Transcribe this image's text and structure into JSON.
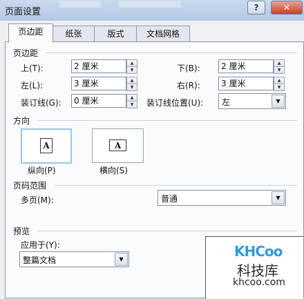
{
  "window": {
    "title": "页面设置",
    "help_label": "?",
    "close_label": "✕"
  },
  "tabs": [
    {
      "label": "页边距",
      "active": true
    },
    {
      "label": "纸张",
      "active": false
    },
    {
      "label": "版式",
      "active": false
    },
    {
      "label": "文档网格",
      "active": false
    }
  ],
  "margins": {
    "heading": "页边距",
    "top_label": "上(T):",
    "top_value": "2 厘米",
    "bottom_label": "下(B):",
    "bottom_value": "2 厘米",
    "left_label": "左(L):",
    "left_value": "3 厘米",
    "right_label": "右(R):",
    "right_value": "3 厘米",
    "gutter_label": "装订线(G):",
    "gutter_value": "0 厘米",
    "gutter_pos_label": "装订线位置(U):",
    "gutter_pos_value": "左"
  },
  "orientation": {
    "heading": "方向",
    "portrait_label": "纵向(P)",
    "landscape_label": "横向(S)",
    "icon_glyph": "A",
    "selected": "portrait"
  },
  "pages": {
    "heading": "页码范围",
    "multiple_label": "多页(M):",
    "multiple_value": "普通"
  },
  "preview": {
    "heading": "预览",
    "apply_label": "应用于(Y):",
    "apply_value": "整篇文档"
  },
  "watermark": {
    "logo": "KHCoo",
    "name": "科技库",
    "url": "khcoo.com"
  },
  "colors": {
    "titlebar": "#b3c8e3",
    "close": "#c4432a",
    "accent": "#2f9be0"
  }
}
